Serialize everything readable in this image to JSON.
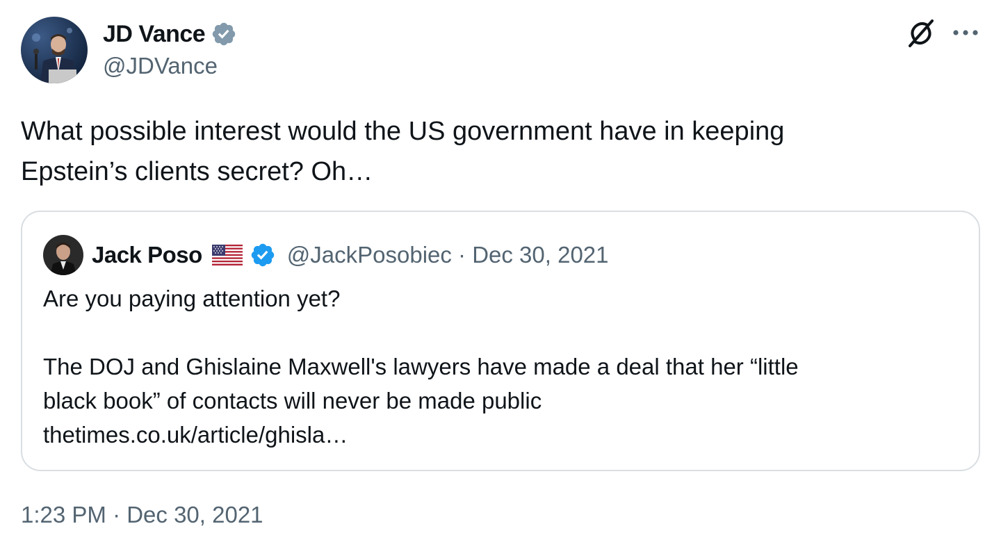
{
  "author": {
    "name": "JD Vance",
    "handle": "@JDVance",
    "verified_color": "#829aab"
  },
  "actions": {
    "grok_icon": "grok-icon",
    "more_icon": "more-icon"
  },
  "tweet": {
    "text": "What possible interest would the US government have in keeping\nEpstein’s clients secret? Oh…",
    "timestamp": "1:23 PM · Dec 30, 2021"
  },
  "quote": {
    "name": "Jack Poso",
    "flag": "us-flag-icon",
    "handle_date": "@JackPosobiec · Dec 30, 2021",
    "verified_color": "#1d9bf0",
    "text": "Are you paying attention yet?\n\nThe DOJ and Ghislaine Maxwell's lawyers have made a deal that her “little\nblack book” of contacts will never be made public\nthetimes.co.uk/article/ghisla…"
  }
}
